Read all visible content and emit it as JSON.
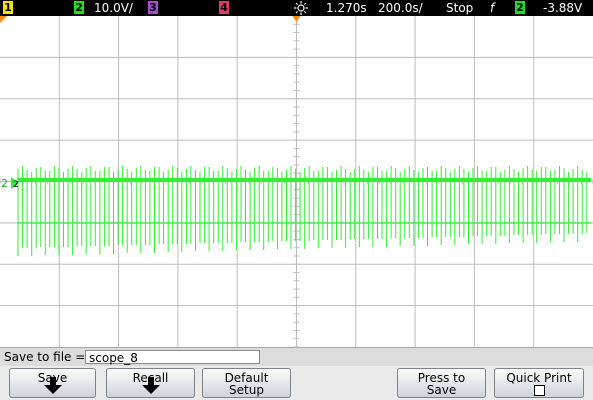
{
  "status_bar": {
    "ch1_label": "1",
    "ch2_label": "2",
    "ch2_scale": "10.0V/",
    "ch3_label": "3",
    "ch4_label": "4",
    "time_offset": "1.270s",
    "time_scale": "200.0s/",
    "run_state": "Stop",
    "trigger_slope_symbol": "f",
    "trigger_source": "2",
    "trigger_level": "-3.88V",
    "colors": {
      "ch1": "#f2e600",
      "ch2": "#22dd22",
      "ch3": "#a050d0",
      "ch4": "#e03a6a"
    }
  },
  "screen": {
    "channel_marker": "2",
    "trace_color": "#33ee33",
    "grid_color": "#bdbdbd",
    "trigger_marker_color": "#ff8a1a",
    "divisions": {
      "horizontal": 10,
      "vertical": 8
    }
  },
  "save_row": {
    "label": "Save to file =",
    "filename": "scope_8"
  },
  "softkeys": {
    "save": "Save",
    "recall": "Recall",
    "default_line1": "Default",
    "default_line2": "Setup",
    "press_line1": "Press to",
    "press_line2": "Save",
    "quick_print": "Quick Print"
  }
}
